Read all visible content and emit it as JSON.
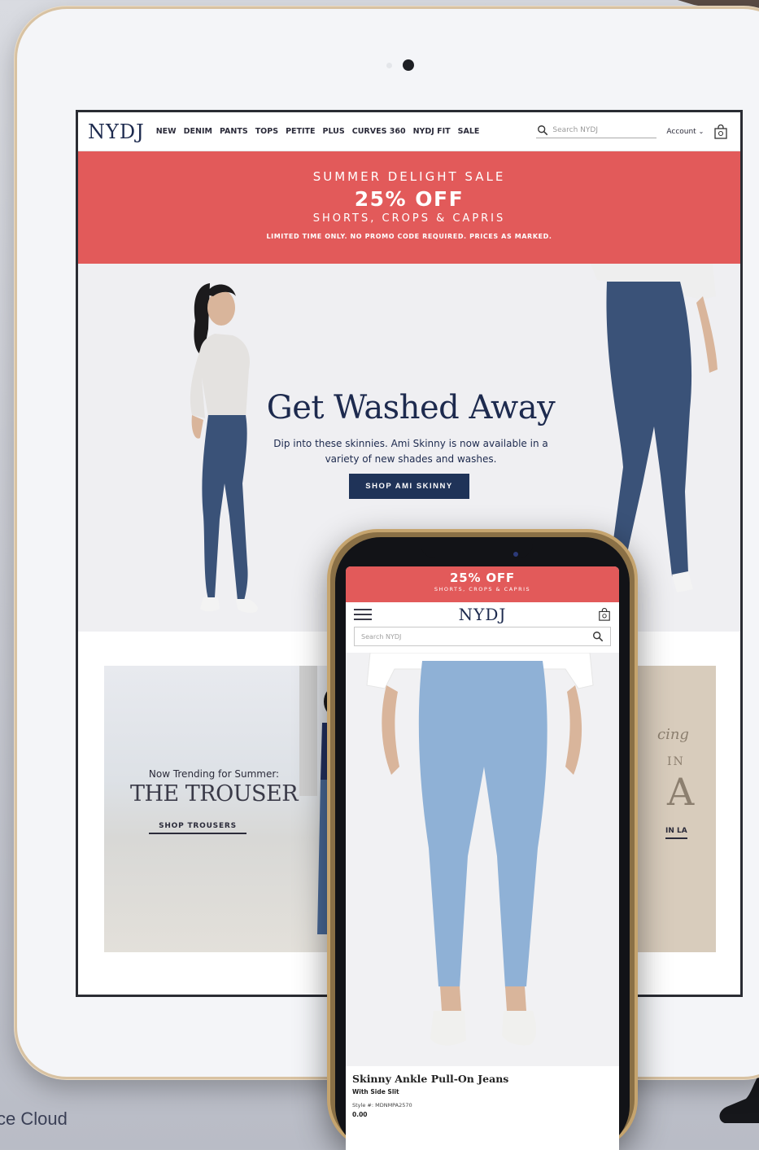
{
  "desktop": {
    "logo": "NYDJ",
    "nav": [
      "NEW",
      "DENIM",
      "PANTS",
      "TOPS",
      "PETITE",
      "PLUS",
      "CURVES 360",
      "NYDJ FIT",
      "SALE"
    ],
    "search_placeholder": "Search NYDJ",
    "account_label": "Account",
    "banner": {
      "line1": "SUMMER DELIGHT SALE",
      "line2": "25% OFF",
      "line3": "SHORTS, CROPS & CAPRIS",
      "line4": "LIMITED TIME ONLY. NO PROMO CODE REQUIRED. PRICES AS MARKED."
    },
    "hero": {
      "title": "Get Washed Away",
      "subtitle": "Dip into these skinnies. Ami Skinny is now available in a variety of new shades and washes.",
      "button": "SHOP AMI SKINNY"
    },
    "tile_left": {
      "kicker": "Now Trending for Summer:",
      "title": "THE TROUSER",
      "cta": "SHOP TROUSERS"
    },
    "tile_right": {
      "t1": "cing",
      "t2": "IN",
      "t3": "A",
      "t4": "IN LA"
    }
  },
  "mobile": {
    "banner_line1": "25% OFF",
    "banner_line2": "SHORTS, CROPS & CAPRIS",
    "logo": "NYDJ",
    "search_placeholder": "Search NYDJ",
    "product": {
      "name": "Skinny Ankle Pull-On Jeans",
      "variant": "With Side Slit",
      "style": "Style #: MDNMPA2570",
      "price": "0.00"
    }
  },
  "caption": "ce Cloud",
  "colors": {
    "sale_red": "#e25a5a",
    "navy": "#1d2a4e",
    "button_navy": "#1f3358",
    "gold_frame": "#c5a46e"
  },
  "icons": [
    "search-icon",
    "chevron-down-icon",
    "shopping-bag-icon",
    "hamburger-menu-icon"
  ]
}
